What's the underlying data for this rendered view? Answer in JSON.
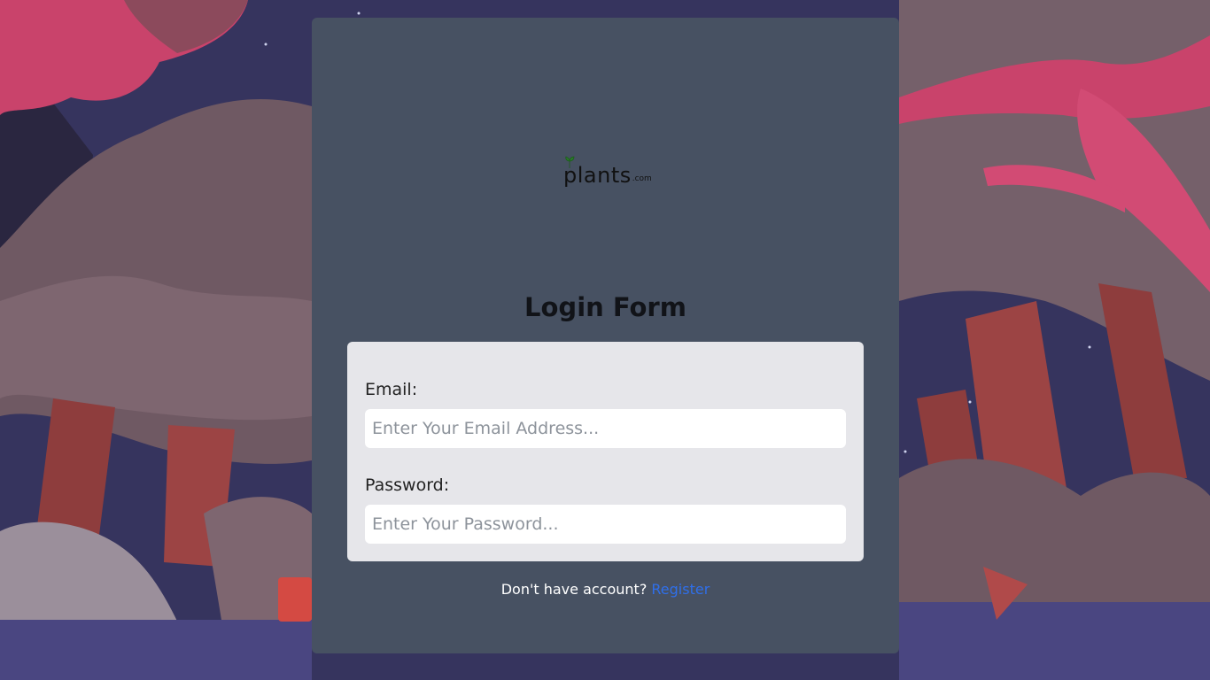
{
  "logo": {
    "name": "plants",
    "suffix": ".com"
  },
  "form": {
    "title": "Login Form",
    "email_label": "Email:",
    "email_placeholder": "Enter Your Email Address...",
    "password_label": "Password:",
    "password_placeholder": "Enter Your Password..."
  },
  "footer": {
    "prompt": "Don't have account?",
    "register_link": "Register"
  },
  "colors": {
    "card": "#475162",
    "form_box": "#e6e6ea",
    "link": "#2f6fea"
  }
}
